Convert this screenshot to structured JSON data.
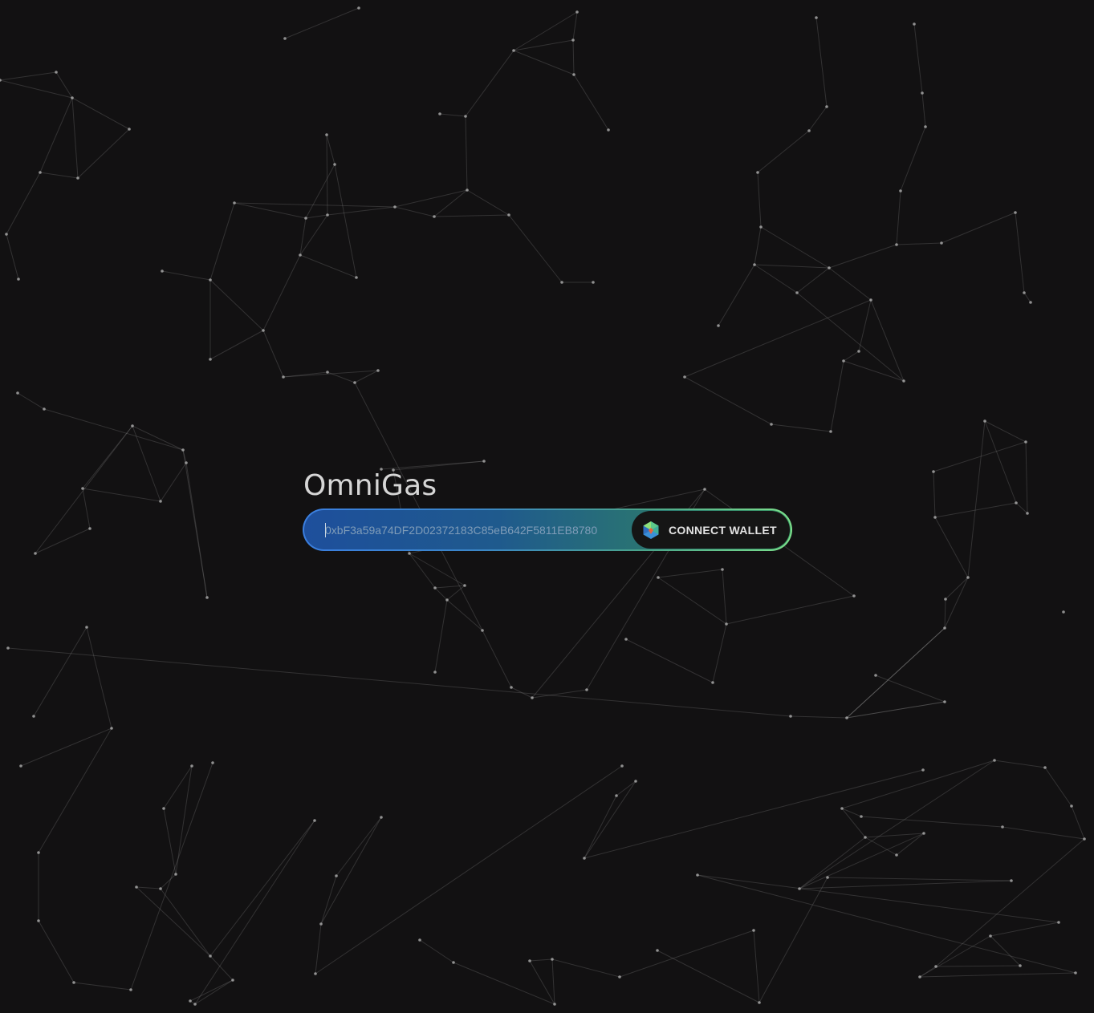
{
  "app": {
    "title": "OmniGas"
  },
  "wallet_bar": {
    "address_placeholder": "0xbF3a59a74DF2D02372183C85eB642F5811EB8780",
    "connect_label": "CONNECT WALLET",
    "wallet_icon": "hexagon-wallet-icon"
  },
  "colors": {
    "background": "#121112",
    "gradient_start": "#1e4f9c",
    "gradient_end": "#3f9c67",
    "border_start": "#3b7fe0",
    "border_end": "#7de08c",
    "title_text": "#d6d6d6"
  }
}
